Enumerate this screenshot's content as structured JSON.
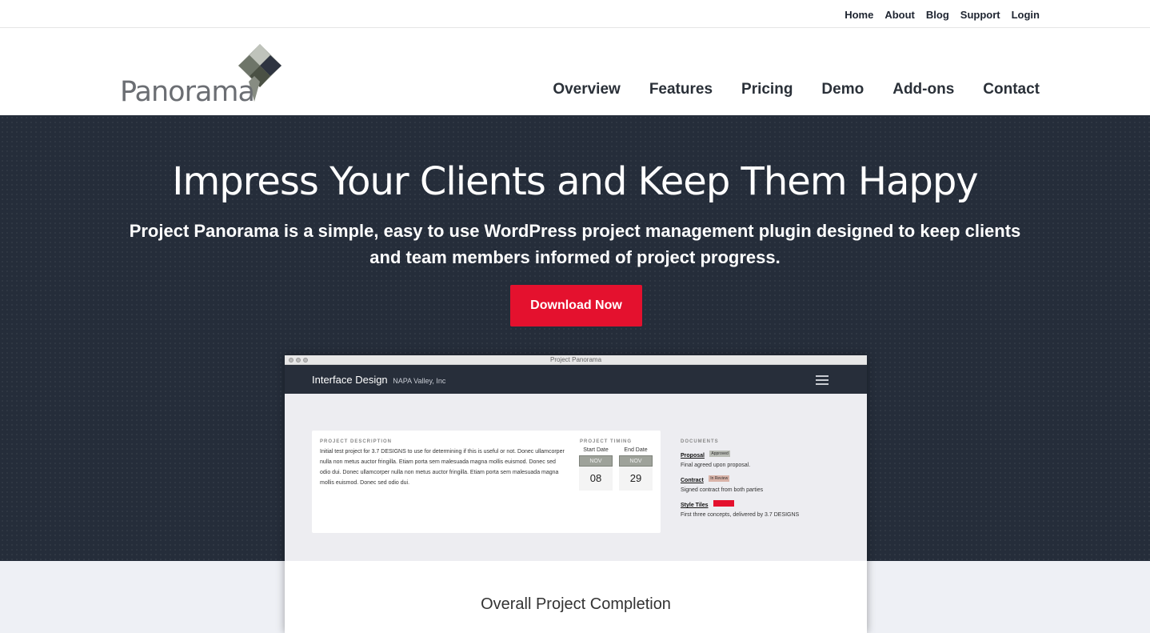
{
  "topnav": [
    "Home",
    "About",
    "Blog",
    "Support",
    "Login"
  ],
  "logo": {
    "text": "Panorama",
    "icon": "panorama-diamond-logo-icon"
  },
  "mainnav": [
    "Overview",
    "Features",
    "Pricing",
    "Demo",
    "Add-ons",
    "Contact"
  ],
  "hero": {
    "title": "Impress Your Clients and Keep Them Happy",
    "subtitle": "Project Panorama is a simple, easy to use WordPress project management plugin designed to keep clients and team members informed of project progress.",
    "cta": "Download Now"
  },
  "colors": {
    "hero_bg": "#252d3a",
    "cta": "#e4112e",
    "nav_text": "#2a3038"
  },
  "preview": {
    "window_title": "Project Panorama",
    "app_title": "Interface Design",
    "app_client": "NAPA Valley, Inc",
    "menu_icon": "hamburger-menu-icon",
    "description_label": "PROJECT DESCRIPTION",
    "description": "Initial test project for 3.7 DESIGNS to use for determining if this is useful or not. Donec ullamcorper nulla non metus auctor fringilla. Etiam porta sem malesuada magna mollis euismod. Donec sed odio dui. Donec ullamcorper nulla non metus auctor fringilla. Etiam porta sem malesuada magna mollis euismod. Donec sed odio dui.",
    "timing_label": "PROJECT TIMING",
    "start": {
      "label": "Start Date",
      "month": "NOV",
      "day": "08"
    },
    "end": {
      "label": "End Date",
      "month": "NOV",
      "day": "29"
    },
    "documents_label": "DOCUMENTS",
    "documents": [
      {
        "name": "Proposal",
        "status": "Approved",
        "desc": "Final agreed upon proposal.",
        "color": "#b9bcb5"
      },
      {
        "name": "Contract",
        "status": "In Review",
        "desc": "Signed contract from both parties",
        "color": "#d9b3a8"
      },
      {
        "name": "Style Tiles",
        "status": "Revisions",
        "desc": "First three concepts, delivered by 3.7 DESIGNS",
        "color": "#e4112e"
      }
    ],
    "completion_title": "Overall Project Completion"
  }
}
